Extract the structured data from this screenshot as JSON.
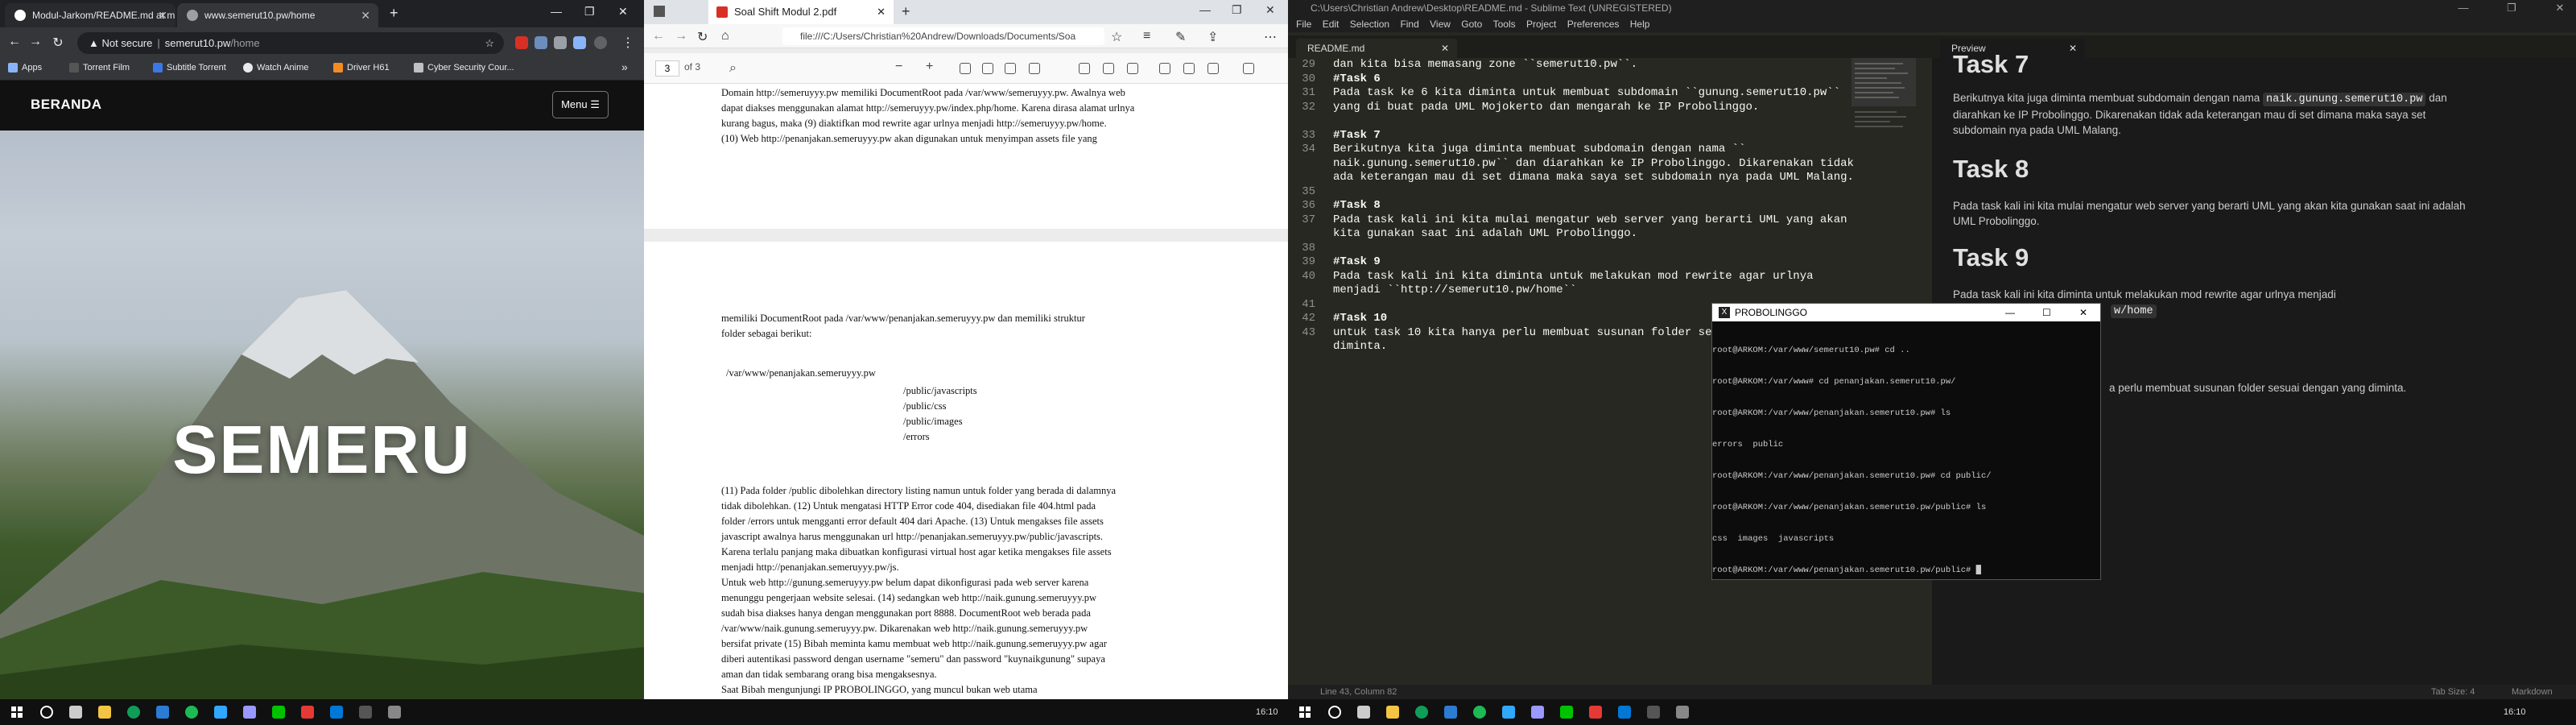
{
  "chrome": {
    "tabs": [
      "Modul-Jarkom/README.md at m",
      "www.semerut10.pw/home"
    ],
    "address": {
      "security": "Not secure",
      "domain": "semerut10.pw",
      "path": "/home"
    },
    "bookmarks": [
      "Apps",
      "Torrent Film",
      "Subtitle Torrent",
      "Watch Anime",
      "Driver H61",
      "Cyber Security Cour..."
    ],
    "site": {
      "brand": "BERANDA",
      "menu": "Menu ☰",
      "hero": "SEMERU"
    }
  },
  "pdf": {
    "tab": "Soal Shift Modul 2.pdf",
    "url": "file:///C:/Users/Christian%20Andrew/Downloads/Documents/Soa",
    "page_current": "3",
    "page_total": "of 3",
    "page1_lines": [
      "Domain http://semeruyyy.pw memiliki DocumentRoot pada /var/www/semeruyyy.pw. Awalnya web",
      "dapat diakses menggunakan alamat http://semeruyyy.pw/index.php/home. Karena dirasa alamat urlnya",
      "kurang bagus, maka (9) diaktifkan mod rewrite agar urlnya menjadi http://semeruyyy.pw/home.",
      "(10) Web http://penanjakan.semeruyyy.pw akan digunakan untuk menyimpan assets file yang"
    ],
    "page2_intro": [
      "memiliki DocumentRoot pada /var/www/penanjakan.semeruyyy.pw dan memiliki struktur",
      "folder sebagai berikut:"
    ],
    "tree_root": "/var/www/penanjakan.semeruyyy.pw",
    "tree_items": [
      "/public/javascripts",
      "/public/css",
      "/public/images",
      "/errors"
    ],
    "page2_lines": [
      "(11) Pada folder /public dibolehkan directory listing namun untuk folder yang berada di dalamnya",
      "tidak dibolehkan. (12) Untuk mengatasi HTTP Error code 404, disediakan file 404.html pada",
      "folder /errors untuk mengganti error default 404 dari Apache. (13) Untuk mengakses file assets",
      "javascript awalnya harus menggunakan url http://penanjakan.semeruyyy.pw/public/javascripts.",
      "Karena terlalu panjang maka dibuatkan konfigurasi virtual host agar ketika mengakses file assets",
      "menjadi http://penanjakan.semeruyyy.pw/js.",
      "Untuk web http://gunung.semeruyyy.pw belum dapat dikonfigurasi pada web server karena",
      "menunggu pengerjaan website selesai. (14) sedangkan web http://naik.gunung.semeruyyy.pw",
      "sudah bisa diakses hanya dengan menggunakan port 8888. DocumentRoot web berada pada",
      "/var/www/naik.gunung.semeruyyy.pw. Dikarenakan web http://naik.gunung.semeruyyy.pw",
      "bersifat private (15) Bibah meminta kamu membuat web http://naik.gunung.semeruyyy.pw agar",
      "diberi autentikasi password dengan username \"semeru\" dan password \"kuynaikgunung\" supaya",
      "aman dan tidak sembarang orang bisa mengaksesnya.",
      "Saat Bibah mengunjungi IP PROBOLINGGO, yang muncul bukan web utama"
    ]
  },
  "sublime": {
    "title": "C:\\Users\\Christian Andrew\\Desktop\\README.md - Sublime Text (UNREGISTERED)",
    "menu": [
      "File",
      "Edit",
      "Selection",
      "Find",
      "View",
      "Goto",
      "Tools",
      "Project",
      "Preferences",
      "Help"
    ],
    "tab_left": "README.md",
    "tab_right": "Preview",
    "line_numbers": [
      "29",
      "30",
      "31",
      "32",
      "33",
      "34",
      "",
      "",
      "35",
      "36",
      "37",
      "38",
      "39",
      "40",
      "",
      "41",
      "42",
      "43"
    ],
    "code_lines": [
      "dan kita bisa memasang zone ``semerut10.pw``.",
      "#Task 6",
      "Pada task ke 6 kita diminta untuk membuat subdomain ``gunung.semerut10.pw``",
      "yang di buat pada UML Mojokerto dan mengarah ke IP Probolinggo.",
      "",
      "#Task 7",
      "Berikutnya kita juga diminta membuat subdomain dengan nama ``",
      "naik.gunung.semerut10.pw`` dan diarahkan ke IP Probolinggo. Dikarenakan tidak",
      "ada keterangan mau di set dimana maka saya set subdomain nya pada UML Malang.",
      "",
      "#Task 8",
      "Pada task kali ini kita mulai mengatur web server yang berarti UML yang akan",
      "kita gunakan saat ini adalah UML Probolinggo.",
      "",
      "#Task 9",
      "Pada task kali ini kita diminta untuk melakukan mod rewrite agar urlnya",
      "menjadi ``http://semerut10.pw/home``",
      "",
      "#Task 10",
      "untuk task 10 kita hanya perlu membuat susunan folder se",
      "diminta."
    ],
    "preview": {
      "top_heading": "Task 7",
      "p7": "Berikutnya kita juga diminta membuat subdomain dengan nama",
      "p7_code": "naik.gunung.semerut10.pw",
      "p7_rest": "dan diarahkan ke IP Probolinggo. Dikarenakan tidak ada keterangan mau di set dimana maka saya set subdomain nya pada UML Malang.",
      "h8": "Task 8",
      "p8": "Pada task kali ini kita mulai mengatur web server yang berarti UML yang akan kita gunakan saat ini adalah UML Probolinggo.",
      "h9": "Task 9",
      "p9": "Pada task kali ini kita diminta untuk melakukan mod rewrite agar urlnya menjadi",
      "p9_code": "w/home",
      "p10": "a perlu membuat susunan folder sesuai dengan yang diminta."
    },
    "status_left": "Line 43, Column 82",
    "status_right": [
      "Tab Size: 4",
      "Markdown"
    ]
  },
  "terminal": {
    "title": "PROBOLINGGO",
    "lines": [
      "root@ARKOM:/var/www/semerut10.pw# cd ..",
      "root@ARKOM:/var/www# cd penanjakan.semerut10.pw/",
      "root@ARKOM:/var/www/penanjakan.semerut10.pw# ls",
      "errors  public",
      "root@ARKOM:/var/www/penanjakan.semerut10.pw# cd public/",
      "root@ARKOM:/var/www/penanjakan.semerut10.pw/public# ls",
      "css  images  javascripts",
      "root@ARKOM:/var/www/penanjakan.semerut10.pw/public# █"
    ]
  },
  "taskbar": {
    "clock_left": "16:10",
    "clock_right": "16:10"
  }
}
